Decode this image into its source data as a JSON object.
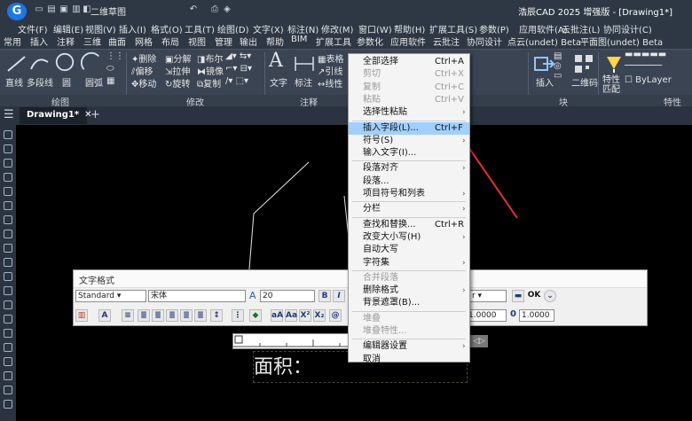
{
  "app_title": "浩辰CAD 2025 增强版 - [Drawing1*]",
  "doc_name": "二维草图",
  "menubar": [
    "文件(F)",
    "编辑(E)",
    "视图(V)",
    "插入(I)",
    "格式(O)",
    "工具(T)",
    "绘图(D)",
    "文字(X)",
    "标注(N)",
    "修改(M)",
    "窗口(W)",
    "帮助(H)",
    "扩展工具(S)",
    "参数(P)",
    "应用软件(A)",
    "云批注(L)",
    "协同设计(C)"
  ],
  "tabs": [
    "常用",
    "插入",
    "注释",
    "三维",
    "曲面",
    "网格",
    "布局",
    "视图",
    "管理",
    "输出",
    "帮助",
    "BIM",
    "扩展工具",
    "参数化",
    "应用软件",
    "云批注",
    "协同设计",
    "点云(undet) Beta",
    "平面图(undet) Beta"
  ],
  "ribbon": {
    "draw": [
      "直线",
      "多段线",
      "圆",
      "圆弧"
    ],
    "modify": [
      "删除",
      "分解",
      "布尔",
      "偏移",
      "拉伸",
      "镜像",
      "移动",
      "旋转",
      "复制"
    ],
    "annotate": [
      "文字",
      "标注",
      "表格",
      "引线",
      "线性"
    ],
    "block": [
      "插入",
      "二维码"
    ],
    "props": [
      "特性",
      "匹配",
      "ByLayer"
    ],
    "panel_titles": [
      "绘图",
      "修改",
      "注释",
      "块",
      "特性"
    ]
  },
  "doc_tab": "Drawing1*",
  "text_format": {
    "title": "文字格式",
    "style": "Standard",
    "font": "宋体",
    "height": "20",
    "bold": "B",
    "italic": "I",
    "ok": "OK",
    "tracking": "1.0000",
    "width_factor": "1.0000",
    "aa_labels": [
      "aA",
      "Aa",
      "X²",
      "X₂"
    ]
  },
  "editor_text": "面积：",
  "context_menu": [
    {
      "label": "全部选择",
      "shortcut": "Ctrl+A"
    },
    {
      "label": "剪切",
      "shortcut": "Ctrl+X",
      "disabled": true
    },
    {
      "label": "复制",
      "shortcut": "Ctrl+C",
      "disabled": true
    },
    {
      "label": "粘贴",
      "shortcut": "Ctrl+V",
      "disabled": true
    },
    {
      "label": "选择性粘贴",
      "submenu": true
    },
    {
      "sep": true
    },
    {
      "label": "插入字段(L)...",
      "shortcut": "Ctrl+F",
      "highlight": true
    },
    {
      "label": "符号(S)",
      "submenu": true
    },
    {
      "label": "输入文字(I)..."
    },
    {
      "sep": true
    },
    {
      "label": "段落对齐",
      "submenu": true
    },
    {
      "label": "段落..."
    },
    {
      "label": "项目符号和列表",
      "submenu": true
    },
    {
      "sep": true
    },
    {
      "label": "分栏",
      "submenu": true
    },
    {
      "sep": true
    },
    {
      "label": "查找和替换...",
      "shortcut": "Ctrl+R"
    },
    {
      "label": "改变大小写(H)",
      "submenu": true
    },
    {
      "label": "自动大写"
    },
    {
      "label": "字符集",
      "submenu": true
    },
    {
      "sep": true
    },
    {
      "label": "合并段落",
      "disabled": true
    },
    {
      "label": "删除格式",
      "submenu": true
    },
    {
      "label": "背景遮罩(B)..."
    },
    {
      "sep": true
    },
    {
      "label": "堆叠",
      "disabled": true
    },
    {
      "label": "堆叠特性...",
      "disabled": true
    },
    {
      "sep": true
    },
    {
      "label": "编辑器设置",
      "submenu": true
    },
    {
      "label": "取消"
    }
  ],
  "colors": {
    "highlight": "#9fd0ff",
    "titlebar": "#2e3744",
    "ribbon": "#3b4453",
    "annotation_arrow": "#e0302a"
  }
}
